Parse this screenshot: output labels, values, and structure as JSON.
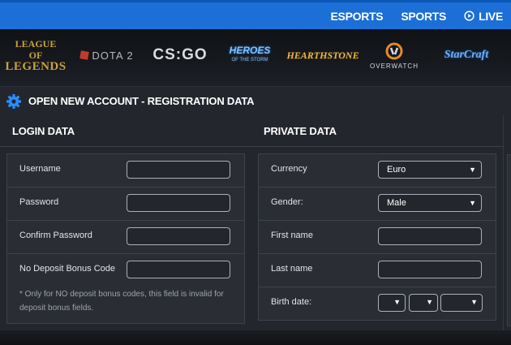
{
  "topnav": {
    "esports": "ESPORTS",
    "sports": "SPORTS",
    "live": "LIVE"
  },
  "games": {
    "lol_line1": "LEAGUE OF",
    "lol_line2": "LEGENDS",
    "dota": "DOTA 2",
    "csgo": "CS:GO",
    "heroes": "HEROES",
    "heroes_sub": "OF THE STORM",
    "hearthstone": "HEARTHSTONE",
    "overwatch": "OVERWATCH",
    "starcraft": "StarCraft"
  },
  "page": {
    "title": "OPEN NEW ACCOUNT - REGISTRATION DATA"
  },
  "login": {
    "heading": "LOGIN DATA",
    "username_label": "Username",
    "username_value": "",
    "password_label": "Password",
    "password_value": "",
    "confirm_label": "Confirm Password",
    "confirm_value": "",
    "bonus_label": "No Deposit Bonus Code",
    "bonus_value": "",
    "note": "* Only for NO deposit bonus codes, this field is invalid for deposit bonus fields."
  },
  "private": {
    "heading": "PRIVATE DATA",
    "currency_label": "Currency",
    "currency_value": "Euro",
    "gender_label": "Gender:",
    "gender_value": "Male",
    "firstname_label": "First name",
    "firstname_value": "",
    "lastname_label": "Last name",
    "lastname_value": "",
    "birthdate_label": "Birth date:"
  },
  "colors": {
    "accent": "#1b6fd6",
    "panel": "#2a2d33",
    "background": "#171a20"
  },
  "icons": {
    "live": "play-circle-icon",
    "title": "gear-icon",
    "dropdown": "caret-down-icon"
  }
}
